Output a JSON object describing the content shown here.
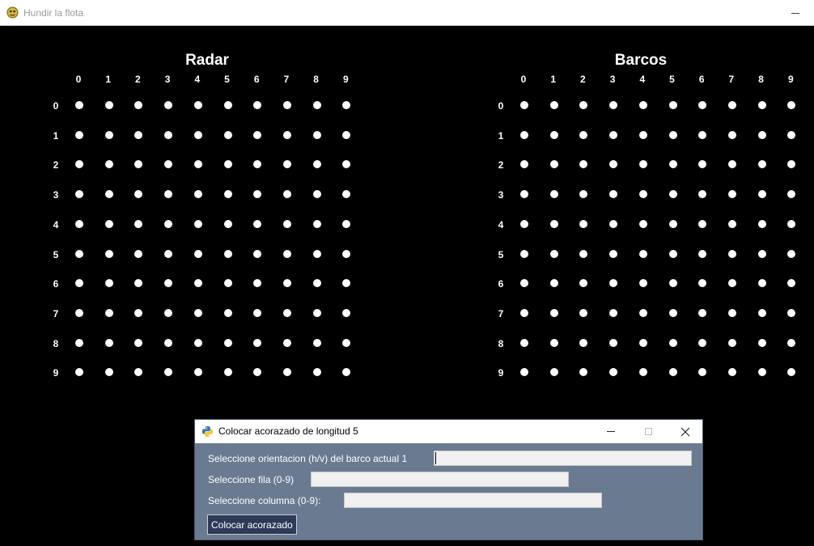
{
  "window": {
    "title": "Hundir la flota",
    "icon": "pygame-snake-icon"
  },
  "boards": [
    {
      "id": "radar",
      "title": "Radar",
      "cols": [
        "0",
        "1",
        "2",
        "3",
        "4",
        "5",
        "6",
        "7",
        "8",
        "9"
      ],
      "rows": [
        "0",
        "1",
        "2",
        "3",
        "4",
        "5",
        "6",
        "7",
        "8",
        "9"
      ]
    },
    {
      "id": "barcos",
      "title": "Barcos",
      "cols": [
        "0",
        "1",
        "2",
        "3",
        "4",
        "5",
        "6",
        "7",
        "8",
        "9"
      ],
      "rows": [
        "0",
        "1",
        "2",
        "3",
        "4",
        "5",
        "6",
        "7",
        "8",
        "9"
      ]
    }
  ],
  "cell_state": "empty",
  "colors": {
    "background": "#000000",
    "dot": "#ffffff",
    "dialog_body": "#6a7a91",
    "button": "#2e3a57"
  },
  "dialog": {
    "title": "Colocar acorazado de longitud 5",
    "icon": "python-icon",
    "orientation_label": "Seleccione orientacion (h/v) del barco actual 1",
    "orientation_value": "",
    "row_label": "Seleccione fila (0-9)",
    "row_value": "",
    "col_label": "Seleccione columna (0-9):",
    "col_value": "",
    "place_button": "Colocar acorazado"
  }
}
